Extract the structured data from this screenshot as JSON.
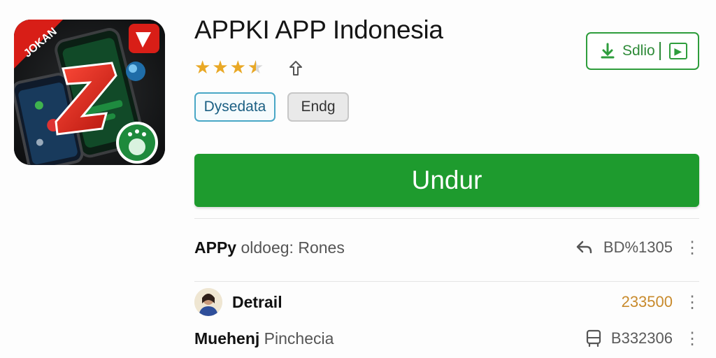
{
  "app": {
    "title": "APPKI APP Indonesia",
    "rating_stars": 3.5,
    "icon_caption": "JOKAN"
  },
  "chips": [
    "Dysedata",
    "Endg"
  ],
  "install_box": {
    "label": "Sdlio",
    "icon": "download-icon",
    "arrow_icon": "chevron-right-icon"
  },
  "main_button": {
    "label": "Undur"
  },
  "rows": [
    {
      "lead_bold": "APPy",
      "lead_rest": " oldoeg: Rones",
      "icon": "reply-arrow-icon",
      "value": "BD%1305"
    },
    {
      "lead_bold": "Detrail",
      "lead_rest": "",
      "icon": "avatar",
      "value": "233500"
    },
    {
      "lead_bold": "Muehenj",
      "lead_rest": " Pinchecia",
      "icon": "bus-icon",
      "value": "B332306"
    }
  ],
  "colors": {
    "accent_green": "#1e9b2e",
    "star": "#e9a825",
    "chip_blue": "#48a7c6",
    "value_orange": "#c88a2c"
  }
}
